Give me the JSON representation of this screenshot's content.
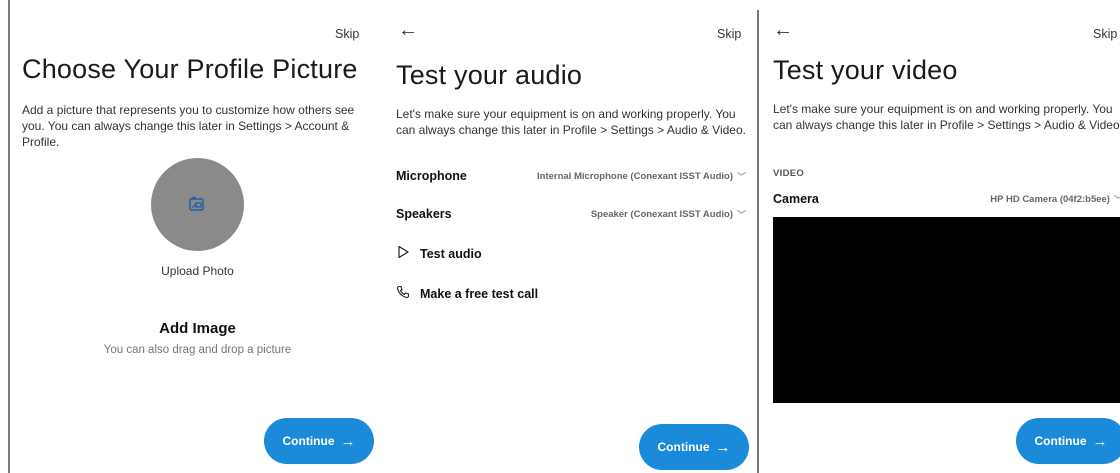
{
  "profile": {
    "skip": "Skip",
    "title": "Choose Your Profile Picture",
    "description": "Add a picture that represents you to customize how others see you. You can always change this later in Settings > Account & Profile.",
    "upload_label": "Upload Photo",
    "add_image": "Add Image",
    "drag_hint": "You can also drag and drop a picture",
    "continue": "Continue",
    "avatar_icon": "image-upload-icon",
    "avatar_color": "#8a8a8a"
  },
  "audio": {
    "back": "←",
    "skip": "Skip",
    "title": "Test your audio",
    "description": "Let's make sure your equipment is on and working properly. You can always change this later in Profile > Settings > Audio & Video.",
    "microphone_label": "Microphone",
    "microphone_value": "Internal Microphone (Conexant ISST Audio)",
    "speakers_label": "Speakers",
    "speakers_value": "Speaker (Conexant ISST Audio)",
    "test_audio": "Test audio",
    "test_call": "Make a free test call",
    "continue": "Continue"
  },
  "video": {
    "back": "←",
    "skip": "Skip",
    "title": "Test your video",
    "description": "Let's make sure your equipment is on and working properly. You can always change this later in Profile > Settings > Audio & Video.",
    "section": "VIDEO",
    "camera_label": "Camera",
    "camera_value": "HP HD Camera (04f2:b5ee)",
    "continue": "Continue"
  },
  "colors": {
    "accent": "#1a8ad9",
    "preview": "#000000"
  }
}
